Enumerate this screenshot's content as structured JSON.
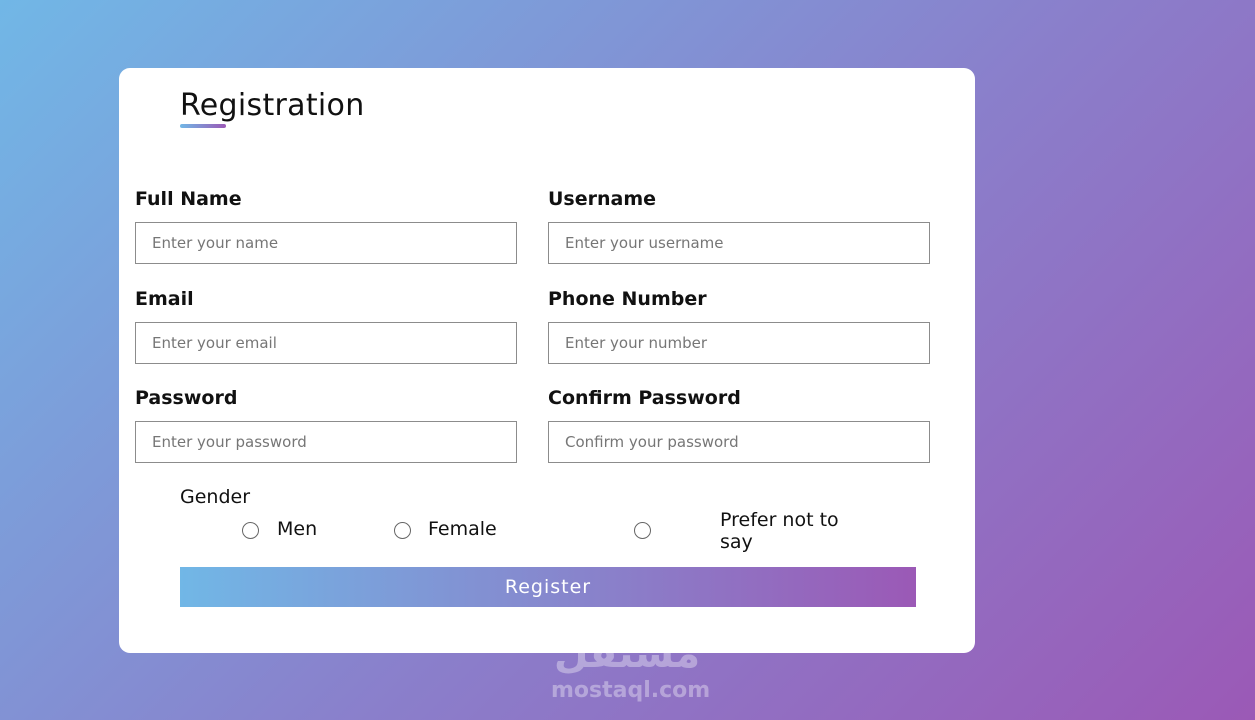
{
  "form": {
    "title": "Registration",
    "fields": {
      "full_name": {
        "label": "Full Name",
        "placeholder": "Enter your name"
      },
      "username": {
        "label": "Username",
        "placeholder": "Enter your username"
      },
      "email": {
        "label": "Email",
        "placeholder": "Enter your email"
      },
      "phone": {
        "label": "Phone Number",
        "placeholder": "Enter your number"
      },
      "password": {
        "label": "Password",
        "placeholder": "Enter your password"
      },
      "confirm_password": {
        "label": "Confirm Password",
        "placeholder": "Confirm your password"
      }
    },
    "gender": {
      "title": "Gender",
      "options": [
        "Men",
        "Female",
        "Prefer not to say"
      ]
    },
    "register_label": "Register"
  },
  "watermark": {
    "arabic": "مستقل",
    "latin": "mostaql.com"
  },
  "colors": {
    "gradient_start": "#71b7e6",
    "gradient_end": "#9b59b6",
    "card_background": "#ffffff"
  }
}
